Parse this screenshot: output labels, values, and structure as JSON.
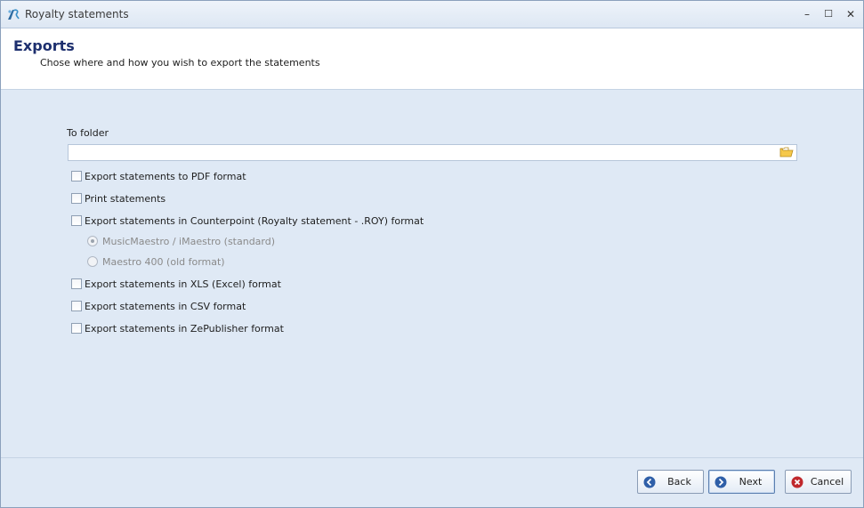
{
  "window": {
    "title": "Royalty statements",
    "controls": {
      "minimize": "–",
      "maximize": "☐",
      "close": "✕"
    }
  },
  "header": {
    "title": "Exports",
    "subtitle": "Chose where and how you wish to export the statements"
  },
  "folder": {
    "label": "To folder",
    "value": "",
    "browse_icon": "folder-open-icon"
  },
  "options": {
    "pdf": {
      "label": "Export statements to PDF format",
      "checked": false
    },
    "print": {
      "label": "Print statements",
      "checked": false
    },
    "counterpoint": {
      "label": "Export statements in Counterpoint (Royalty statement - .ROY) format",
      "checked": false
    },
    "radio_standard": {
      "label": "MusicMaestro / iMaestro (standard)",
      "selected": true,
      "enabled": false
    },
    "radio_old": {
      "label": "Maestro 400 (old format)",
      "selected": false,
      "enabled": false
    },
    "xls": {
      "label": "Export statements in XLS (Excel) format",
      "checked": false
    },
    "csv": {
      "label": "Export statements in CSV format",
      "checked": false
    },
    "zepublisher": {
      "label": "Export statements in ZePublisher format",
      "checked": false
    }
  },
  "footer": {
    "back": "Back",
    "next": "Next",
    "cancel": "Cancel"
  },
  "colors": {
    "background": "#dfe9f5",
    "header_title": "#1d2f6e",
    "button_icon_blue": "#2f5fa8",
    "cancel_icon_red": "#c0282c"
  }
}
